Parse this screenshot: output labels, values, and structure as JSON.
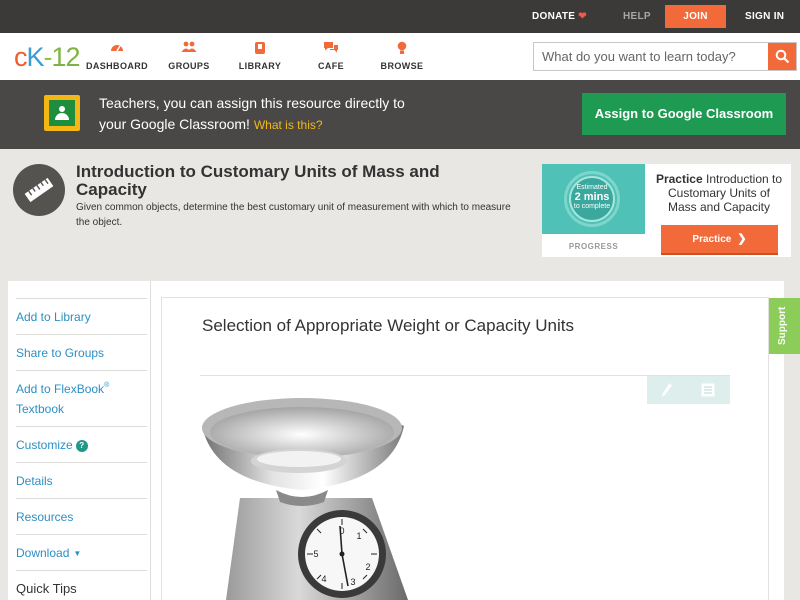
{
  "topbar": {
    "donate": "DONATE",
    "help": "HELP",
    "join": "JOIN",
    "signin": "SIGN IN"
  },
  "nav": {
    "logo": {
      "c": "c",
      "k": "K",
      "dash": "-",
      "num": "12"
    },
    "items": [
      {
        "label": "DASHBOARD",
        "icon": "dashboard-icon"
      },
      {
        "label": "GROUPS",
        "icon": "groups-icon"
      },
      {
        "label": "LIBRARY",
        "icon": "library-icon"
      },
      {
        "label": "CAFE",
        "icon": "cafe-icon"
      },
      {
        "label": "BROWSE",
        "icon": "browse-icon"
      }
    ],
    "search_placeholder": "What do you want to learn today?"
  },
  "banner": {
    "line1": "Teachers, you can assign this resource directly to",
    "line2": "your Google Classroom!",
    "what": "What is this?",
    "assign_button": "Assign to Google Classroom"
  },
  "concept": {
    "title": "Introduction to Customary Units of Mass and Capacity",
    "description": "Given common objects, determine the best customary unit of measurement with which to measure the object."
  },
  "practice": {
    "estimated": "Estimated",
    "mins": "2 mins",
    "to_complete": "to complete",
    "progress_label": "PROGRESS",
    "text_bold": "Practice",
    "text_rest": "Introduction to Customary Units of Mass and Capacity",
    "button": "Practice"
  },
  "sidebar": {
    "items": [
      "Add to Library",
      "Share to Groups",
      "Add to FlexBook",
      "Textbook",
      "Customize",
      "Details",
      "Resources",
      "Download",
      "Quick Tips"
    ],
    "flexbook_sup": "®",
    "help_mark": "?"
  },
  "content": {
    "section_title": "Selection of Appropriate Weight or Capacity Units"
  },
  "support": "Support",
  "colors": {
    "accent": "#f26a3a",
    "green_button": "#1f9a53",
    "link": "#2c8fc5",
    "support_tab": "#8ccc58"
  }
}
